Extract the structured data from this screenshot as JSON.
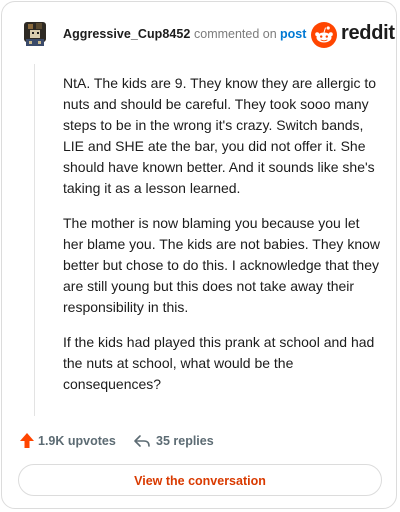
{
  "header": {
    "username": "Aggressive_Cup8452",
    "commented_on": "commented on",
    "post_link": "post",
    "brand_name": "reddit"
  },
  "comment": {
    "paragraphs": [
      "NtA. The kids are 9. They know they are allergic to nuts and should be careful. They took sooo many steps to be in the wrong it's crazy. Switch bands, LIE and SHE ate the bar, you did not offer it. She should have known better. And it sounds like she's taking it as a lesson learned.",
      "The mother is now blaming you because you let her blame you. The kids are not babies. They know better but chose to do this. I acknowledge that they are still young but this does not take away their responsibility in this.",
      "If the kids had played this prank at school and had the nuts at school, what would be the consequences?"
    ]
  },
  "stats": {
    "upvotes": "1.9K upvotes",
    "replies": "35 replies"
  },
  "footer": {
    "view_button": "View the conversation"
  },
  "colors": {
    "brand_orange": "#ff4500",
    "link_blue": "#0079d3",
    "button_text": "#d93a00",
    "muted": "#7c7c7c"
  },
  "icons": {
    "avatar": "user-avatar",
    "brand": "reddit-snoo-icon",
    "upvote": "upvote-arrow-icon",
    "reply": "reply-arrow-icon"
  }
}
